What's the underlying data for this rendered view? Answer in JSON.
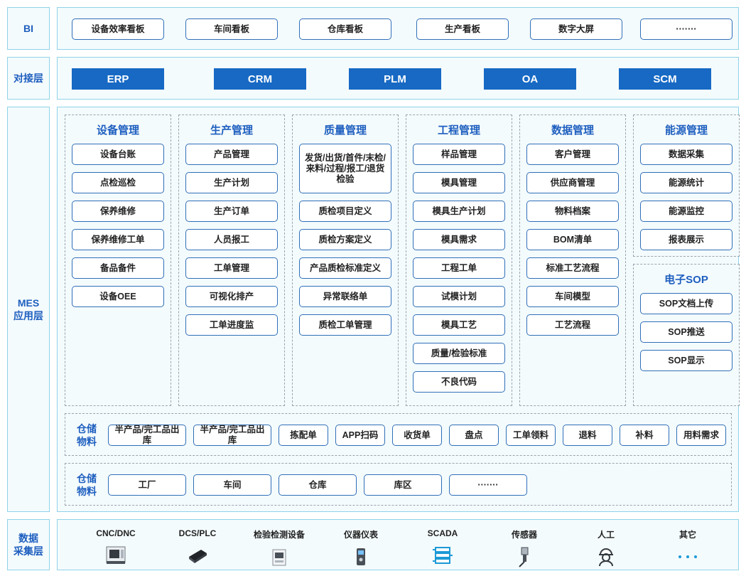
{
  "layers": {
    "bi": "BI",
    "interface": "对接层",
    "mes": "MES\n应用层",
    "acquisition": "数据\n采集层"
  },
  "bi_items": [
    "设备效率看板",
    "车间看板",
    "仓库看板",
    "生产看板",
    "数字大屏",
    "·······"
  ],
  "interface_items": [
    "ERP",
    "CRM",
    "PLM",
    "OA",
    "SCM"
  ],
  "modules": [
    {
      "title": "设备管理",
      "items": [
        "设备台账",
        "点检巡检",
        "保养维修",
        "保养维修工单",
        "备品备件",
        "设备OEE"
      ]
    },
    {
      "title": "生产管理",
      "items": [
        "产品管理",
        "生产计划",
        "生产订单",
        "人员报工",
        "工单管理",
        "可视化排产",
        "工单进度监"
      ]
    },
    {
      "title": "质量管理",
      "items": [
        "发货/出货/首件/末检/来料/过程/报工/退货检验",
        "质检项目定义",
        "质检方案定义",
        "产品质检标准定义",
        "异常联络单",
        "质检工单管理"
      ]
    },
    {
      "title": "工程管理",
      "items": [
        "样品管理",
        "模具管理",
        "模具生产计划",
        "模具需求",
        "工程工单",
        "试模计划",
        "模具工艺",
        "质量/检验标准",
        "不良代码"
      ]
    },
    {
      "title": "数据管理",
      "items": [
        "客户管理",
        "供应商管理",
        "物料档案",
        "BOM清单",
        "标准工艺流程",
        "车间模型",
        "工艺流程"
      ]
    },
    {
      "title": "能源管理",
      "items": [
        "数据采集",
        "能源统计",
        "能源监控",
        "报表展示"
      ]
    },
    {
      "title": "电子SOP",
      "items": [
        "SOP文档上传",
        "SOP推送",
        "SOP显示"
      ]
    }
  ],
  "warehouse_row1": {
    "label": "仓储\n物料",
    "items": [
      "半产品/完工品出库",
      "半产品/完工品出库",
      "拣配单",
      "APP扫码",
      "收货单",
      "盘点",
      "工单领料",
      "退料",
      "补料",
      "用料需求"
    ]
  },
  "warehouse_row2": {
    "label": "仓储\n物料",
    "items": [
      "工厂",
      "车间",
      "仓库",
      "库区",
      "·······"
    ]
  },
  "devices": [
    {
      "name": "CNC/DNC",
      "icon": "cnc-machine-icon"
    },
    {
      "name": "DCS/PLC",
      "icon": "plc-controller-icon"
    },
    {
      "name": "检验检测设备",
      "icon": "inspection-device-icon"
    },
    {
      "name": "仪器仪表",
      "icon": "meter-icon"
    },
    {
      "name": "SCADA",
      "icon": "scada-icon"
    },
    {
      "name": "传感器",
      "icon": "sensor-icon"
    },
    {
      "name": "人工",
      "icon": "worker-icon"
    },
    {
      "name": "其它",
      "icon": "more-dots-icon"
    }
  ],
  "colors": {
    "accent": "#1769c4",
    "title": "#1e5fbf",
    "border": "#8fd3e8",
    "background": "#f4fbfd"
  }
}
